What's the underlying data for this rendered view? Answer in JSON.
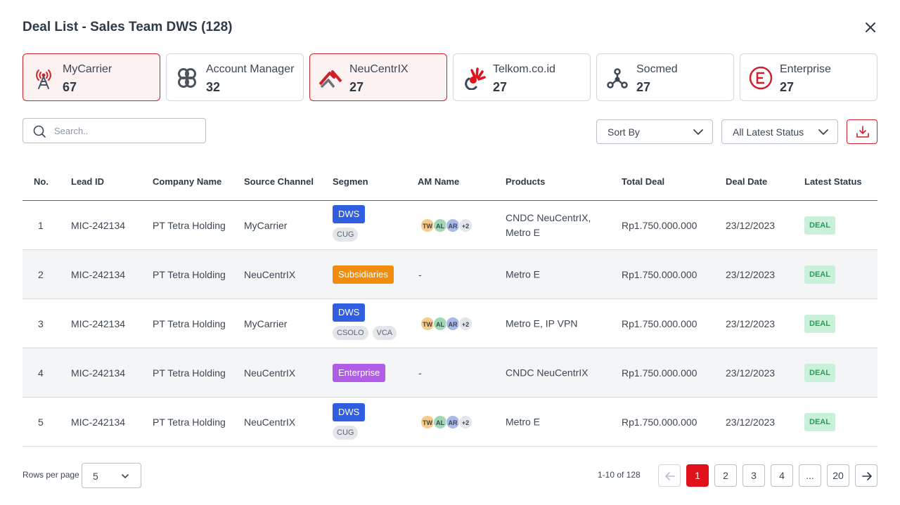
{
  "title": "Deal List - Sales Team DWS (128)",
  "cards": [
    {
      "label": "MyCarrier",
      "count": "67",
      "icon": "cell-tower-icon",
      "active": true
    },
    {
      "label": "Account Manager",
      "count": "32",
      "icon": "account-manager-icon",
      "active": false
    },
    {
      "label": "NeuCentrIX",
      "count": "27",
      "icon": "neucentrix-logo-icon",
      "active": true
    },
    {
      "label": "Telkom.co.id",
      "count": "27",
      "icon": "telkom-logo-icon",
      "active": false
    },
    {
      "label": "Socmed",
      "count": "27",
      "icon": "share-network-icon",
      "active": false
    },
    {
      "label": "Enterprise",
      "count": "27",
      "icon": "enterprise-e-icon",
      "active": false
    }
  ],
  "search": {
    "placeholder": "Search.."
  },
  "sort": {
    "label": "Sort By"
  },
  "status_filter": {
    "label": "All Latest Status"
  },
  "columns": {
    "no": "No.",
    "lead_id": "Lead ID",
    "company": "Company Name",
    "source": "Source Channel",
    "segmen": "Segmen",
    "am": "AM Name",
    "products": "Products",
    "total": "Total Deal",
    "date": "Deal Date",
    "status": "Latest Status"
  },
  "rows": [
    {
      "no": "1",
      "lead_id": "MIC-242134",
      "company": "PT Tetra Holding",
      "source": "MyCarrier",
      "segmen": "DWS",
      "tags": [
        "CUG"
      ],
      "am": [
        "TW",
        "AL",
        "AR",
        "+2"
      ],
      "products": "CNDC NeuCentrIX, Metro E",
      "total": "Rp1.750.000.000",
      "date": "23/12/2023",
      "status": "DEAL"
    },
    {
      "no": "2",
      "lead_id": "MIC-242134",
      "company": "PT Tetra Holding",
      "source": "NeuCentrIX",
      "segmen": "Subsidiaries",
      "tags": [],
      "am_text": "-",
      "products": "Metro E",
      "total": "Rp1.750.000.000",
      "date": "23/12/2023",
      "status": "DEAL"
    },
    {
      "no": "3",
      "lead_id": "MIC-242134",
      "company": "PT Tetra Holding",
      "source": "MyCarrier",
      "segmen": "DWS",
      "tags": [
        "CSOLO",
        "VCA"
      ],
      "am": [
        "TW",
        "AL",
        "AR",
        "+2"
      ],
      "products": "Metro E, IP VPN",
      "total": "Rp1.750.000.000",
      "date": "23/12/2023",
      "status": "DEAL"
    },
    {
      "no": "4",
      "lead_id": "MIC-242134",
      "company": "PT Tetra Holding",
      "source": "NeuCentrIX",
      "segmen": "Enterprise",
      "tags": [],
      "am_text": "-",
      "products": "CNDC NeuCentrIX",
      "total": "Rp1.750.000.000",
      "date": "23/12/2023",
      "status": "DEAL"
    },
    {
      "no": "5",
      "lead_id": "MIC-242134",
      "company": "PT Tetra Holding",
      "source": "NeuCentrIX",
      "segmen": "DWS",
      "tags": [
        "CUG"
      ],
      "am": [
        "TW",
        "AL",
        "AR",
        "+2"
      ],
      "products": "Metro E",
      "total": "Rp1.750.000.000",
      "date": "23/12/2023",
      "status": "DEAL"
    }
  ],
  "segment_colors": {
    "DWS": "#2f5fe0",
    "Subsidiaries": "#f28c0c",
    "Enterprise": "#b15ce6"
  },
  "avatar_colors": [
    "#f8c987",
    "#9fd9b4",
    "#a9b9e8",
    "#e3e6ea"
  ],
  "footer": {
    "rows_per_page_label": "Rows per page",
    "rows_per_page_value": "5",
    "range": "1-10 of 128",
    "pages": [
      "1",
      "2",
      "3",
      "4",
      "...",
      "20"
    ],
    "current_page": "1"
  }
}
